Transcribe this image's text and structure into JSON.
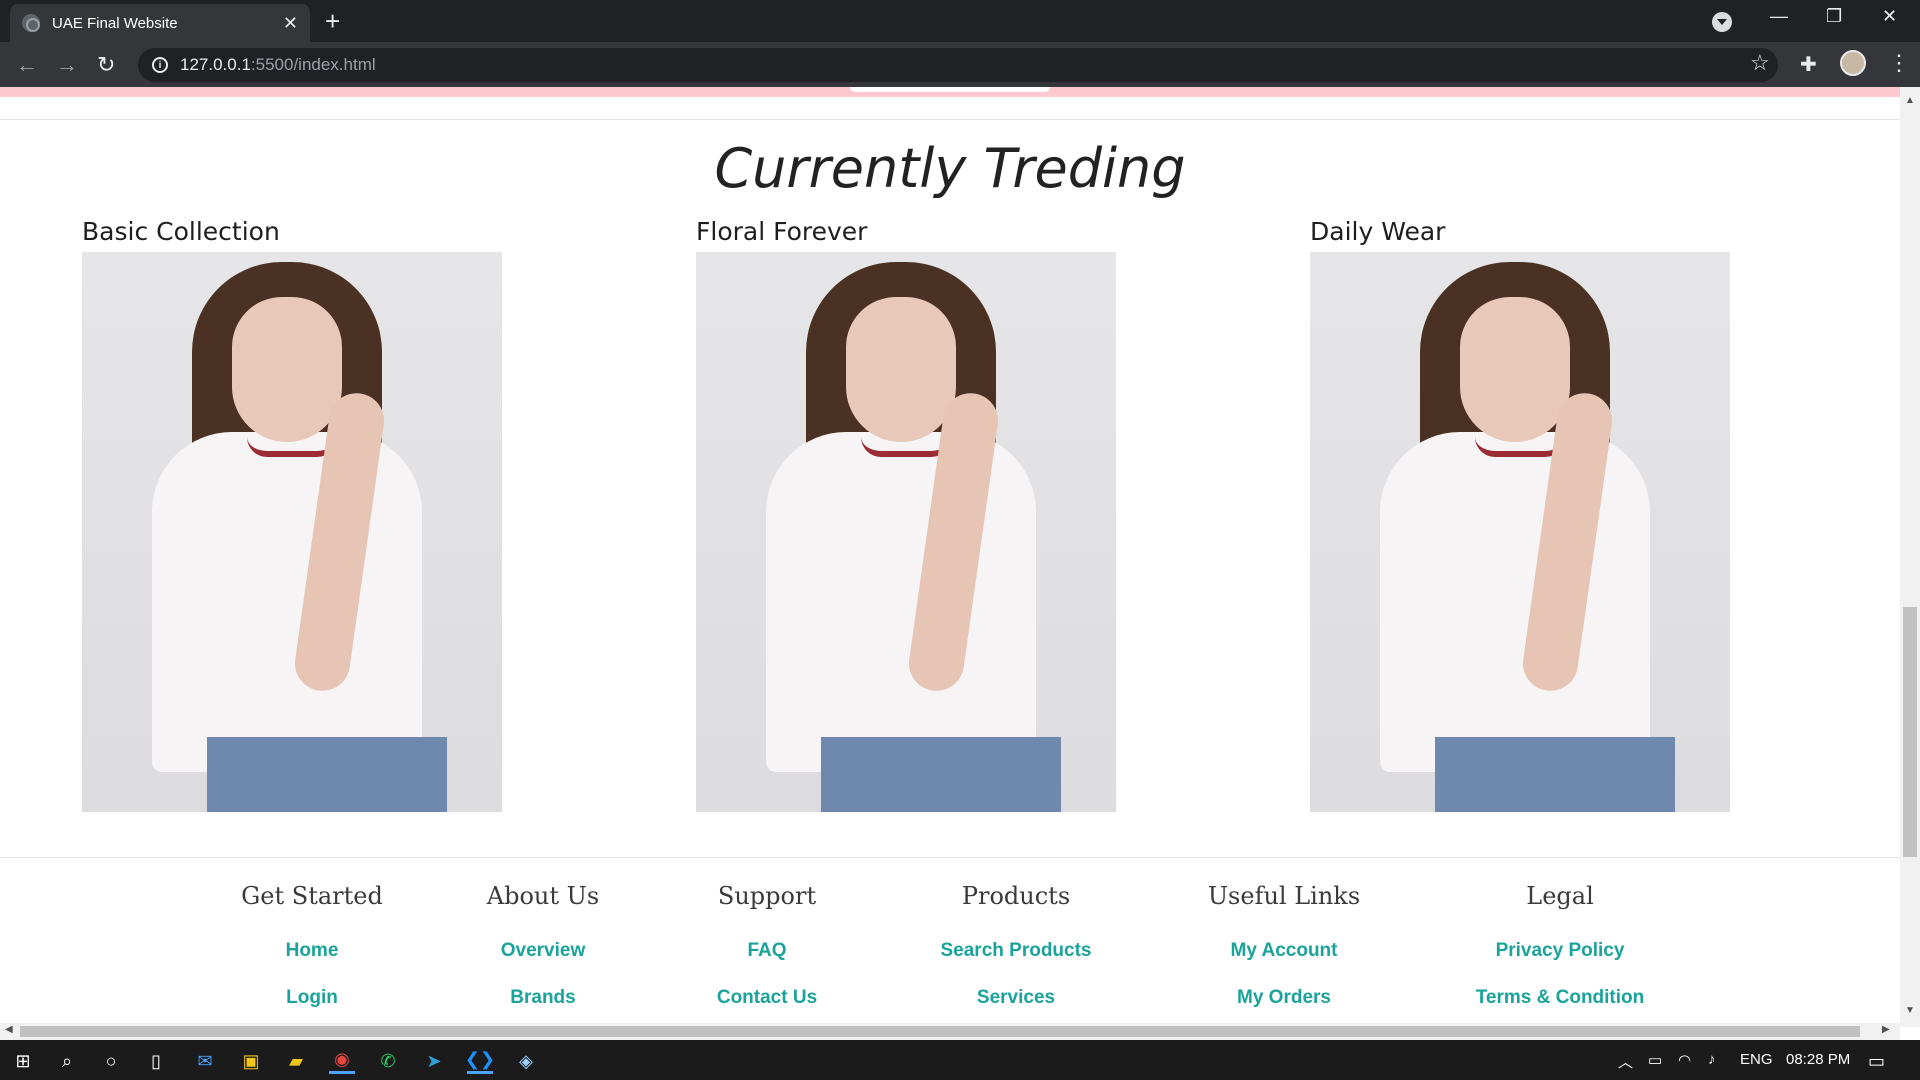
{
  "browser": {
    "tab_title": "UAE Final Website",
    "tab_close": "✕",
    "new_tab": "+",
    "url_host": "127.0.0.1",
    "url_path": ":5500/index.html",
    "window_controls": {
      "minimize": "—",
      "restore": "❐",
      "close": "✕"
    }
  },
  "trending": {
    "title": "Currently Treding",
    "cards": [
      {
        "label": "Basic Collection"
      },
      {
        "label": "Floral Forever"
      },
      {
        "label": "Daily Wear"
      }
    ]
  },
  "footer": {
    "columns": [
      {
        "heading": "Get Started",
        "links": [
          "Home",
          "Login"
        ]
      },
      {
        "heading": "About Us",
        "links": [
          "Overview",
          "Brands"
        ]
      },
      {
        "heading": "Support",
        "links": [
          "FAQ",
          "Contact Us"
        ]
      },
      {
        "heading": "Products",
        "links": [
          "Search Products",
          "Services"
        ]
      },
      {
        "heading": "Useful Links",
        "links": [
          "My Account",
          "My Orders"
        ]
      },
      {
        "heading": "Legal",
        "links": [
          "Privacy Policy",
          "Terms & Condition"
        ]
      }
    ]
  },
  "taskbar": {
    "language": "ENG",
    "time": "08:28 PM"
  },
  "colors": {
    "link": "#1aa39a",
    "pink_bar": "#ffc7d0",
    "chrome_dark": "#202124"
  }
}
